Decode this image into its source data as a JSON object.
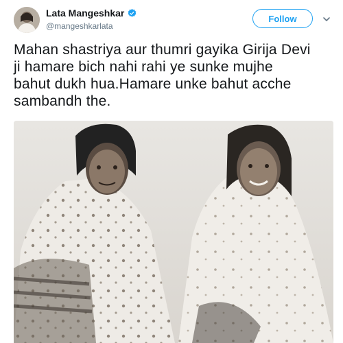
{
  "user": {
    "display_name": "Lata Mangeshkar",
    "handle": "@mangeshkarlata",
    "verified_icon": "verified-badge-icon",
    "avatar": "profile-avatar"
  },
  "follow_button": {
    "label": "Follow"
  },
  "menu_icon": "chevron-down-icon",
  "tweet": {
    "text": "Mahan shastriya aur thumri gayika Girija Devi\nji hamare bich nahi rahi ye sunke mujhe\nbahut dukh hua.Hamare unke bahut acche\nsambandh the."
  },
  "media": {
    "description_icon": "attached-photo"
  },
  "colors": {
    "accent": "#1da1f2",
    "text": "#14171a",
    "secondary": "#657786"
  }
}
